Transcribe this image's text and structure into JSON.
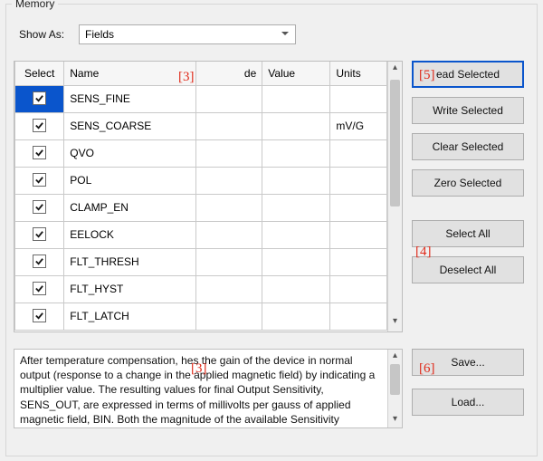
{
  "group_title": "Memory",
  "show_as": {
    "label": "Show As:",
    "selected": "Fields"
  },
  "table": {
    "headers": {
      "select": "Select",
      "name": "Name",
      "code": "de",
      "value": "Value",
      "units": "Units"
    },
    "rows": [
      {
        "selected": true,
        "name": "SENS_FINE",
        "code": "",
        "value": "",
        "units": "",
        "highlight": true
      },
      {
        "selected": true,
        "name": "SENS_COARSE",
        "code": "",
        "value": "",
        "units": "mV/G",
        "highlight": false
      },
      {
        "selected": true,
        "name": "QVO",
        "code": "",
        "value": "",
        "units": "",
        "highlight": false
      },
      {
        "selected": true,
        "name": "POL",
        "code": "",
        "value": "",
        "units": "",
        "highlight": false
      },
      {
        "selected": true,
        "name": "CLAMP_EN",
        "code": "",
        "value": "",
        "units": "",
        "highlight": false
      },
      {
        "selected": true,
        "name": "EELOCK",
        "code": "",
        "value": "",
        "units": "",
        "highlight": false
      },
      {
        "selected": true,
        "name": "FLT_THRESH",
        "code": "",
        "value": "",
        "units": "",
        "highlight": false
      },
      {
        "selected": true,
        "name": "FLT_HYST",
        "code": "",
        "value": "",
        "units": "",
        "highlight": false
      },
      {
        "selected": true,
        "name": "FLT_LATCH",
        "code": "",
        "value": "",
        "units": "",
        "highlight": false
      }
    ]
  },
  "buttons": {
    "read": "ead  Selected",
    "write": "Write Selected",
    "clear": "Clear Selected",
    "zero": "Zero Selected",
    "selall": "Select All",
    "desel": "Deselect All",
    "save": "Save...",
    "load": "Load..."
  },
  "description": "After temperature compensation,            hes the gain of the device in normal output (response to a change in the applied magnetic field) by indicating a multiplier value. The resulting values for final Output Sensitivity, SENS_OUT, are expressed in terms of millivolts per gauss of applied magnetic field, BIN. Both the magnitude of the available Sensitivity",
  "annotations": {
    "a3a": "[3]",
    "a3b": "[3]",
    "a4": "[4]",
    "a5": "[5]",
    "a6": "[6]"
  }
}
